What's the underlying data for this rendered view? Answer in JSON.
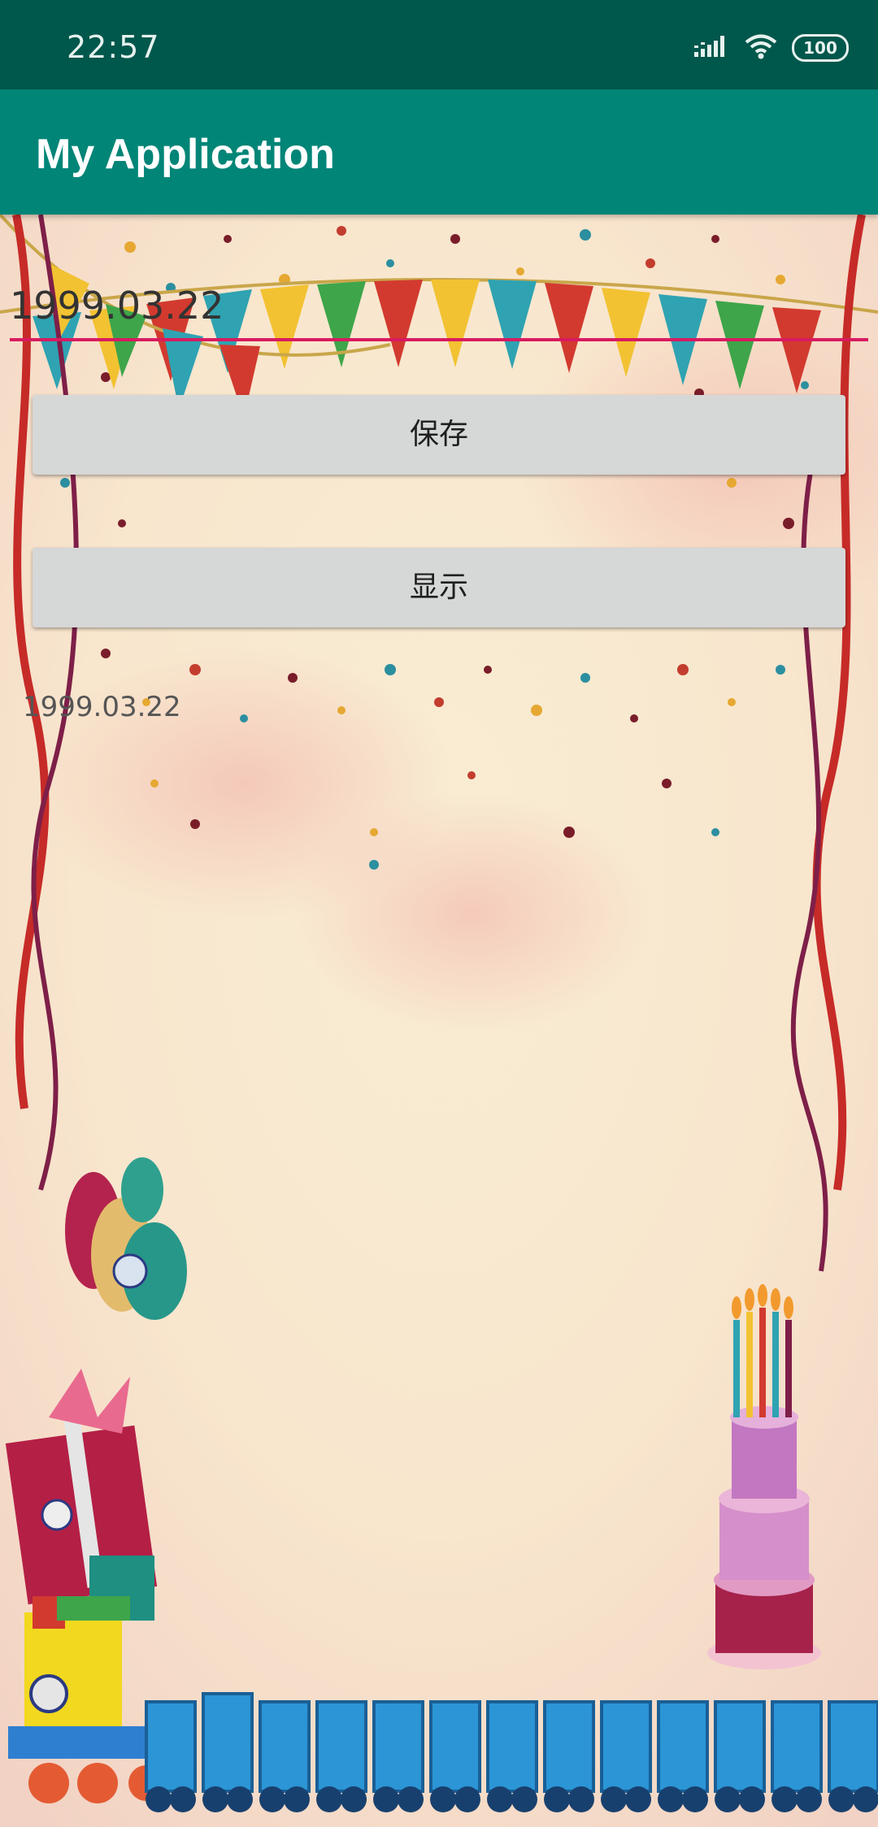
{
  "status_bar": {
    "time": "22:57",
    "battery": "100",
    "icons": [
      "signal-icon",
      "wifi-icon",
      "battery-icon"
    ]
  },
  "app_bar": {
    "title": "My Application",
    "color": "#008577",
    "status_color": "#00574b"
  },
  "form": {
    "date_value": "1999.03.22",
    "underline_color": "#d81b60",
    "save_label": "保存",
    "show_label": "显示",
    "display_text": "1999.03.22"
  }
}
